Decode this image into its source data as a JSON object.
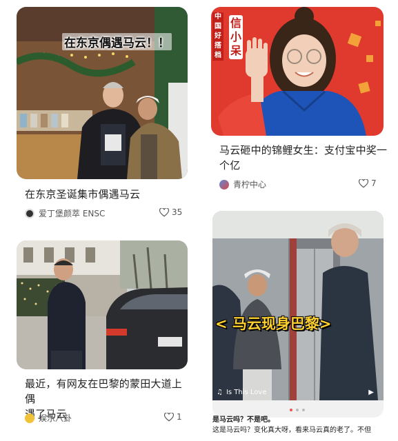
{
  "cards": [
    {
      "overlay": "在东京偶遇马云！！",
      "title": "在东京圣诞集市偶遇马云",
      "author": "爱丁堡颜萃 ENSC",
      "likes": "35"
    },
    {
      "overlay_side_left": "中国好搭档",
      "overlay_side_right": "信小呆",
      "title_line1": "马云砸中的锦鲤女生：支付宝中奖一",
      "title_line2": "个亿",
      "author": "青柠中心",
      "likes": "7"
    },
    {
      "title_line1": "最近，有网友在巴黎的蒙田大道上偶",
      "title_line2": "遇了马云",
      "author": "娱乐八卦",
      "likes": "1"
    },
    {
      "overlay": "< 马云现身巴黎>",
      "music": "Is This Love",
      "caption_line1": "是马云吗？不是吧。",
      "caption_line2": "这是马云吗？变化真大呀，看来马云真的老了。不但"
    }
  ],
  "colors": {
    "like_gray": "#555555",
    "card2_bg": "#e03a2f",
    "shirt_blue": "#1e54b7"
  }
}
